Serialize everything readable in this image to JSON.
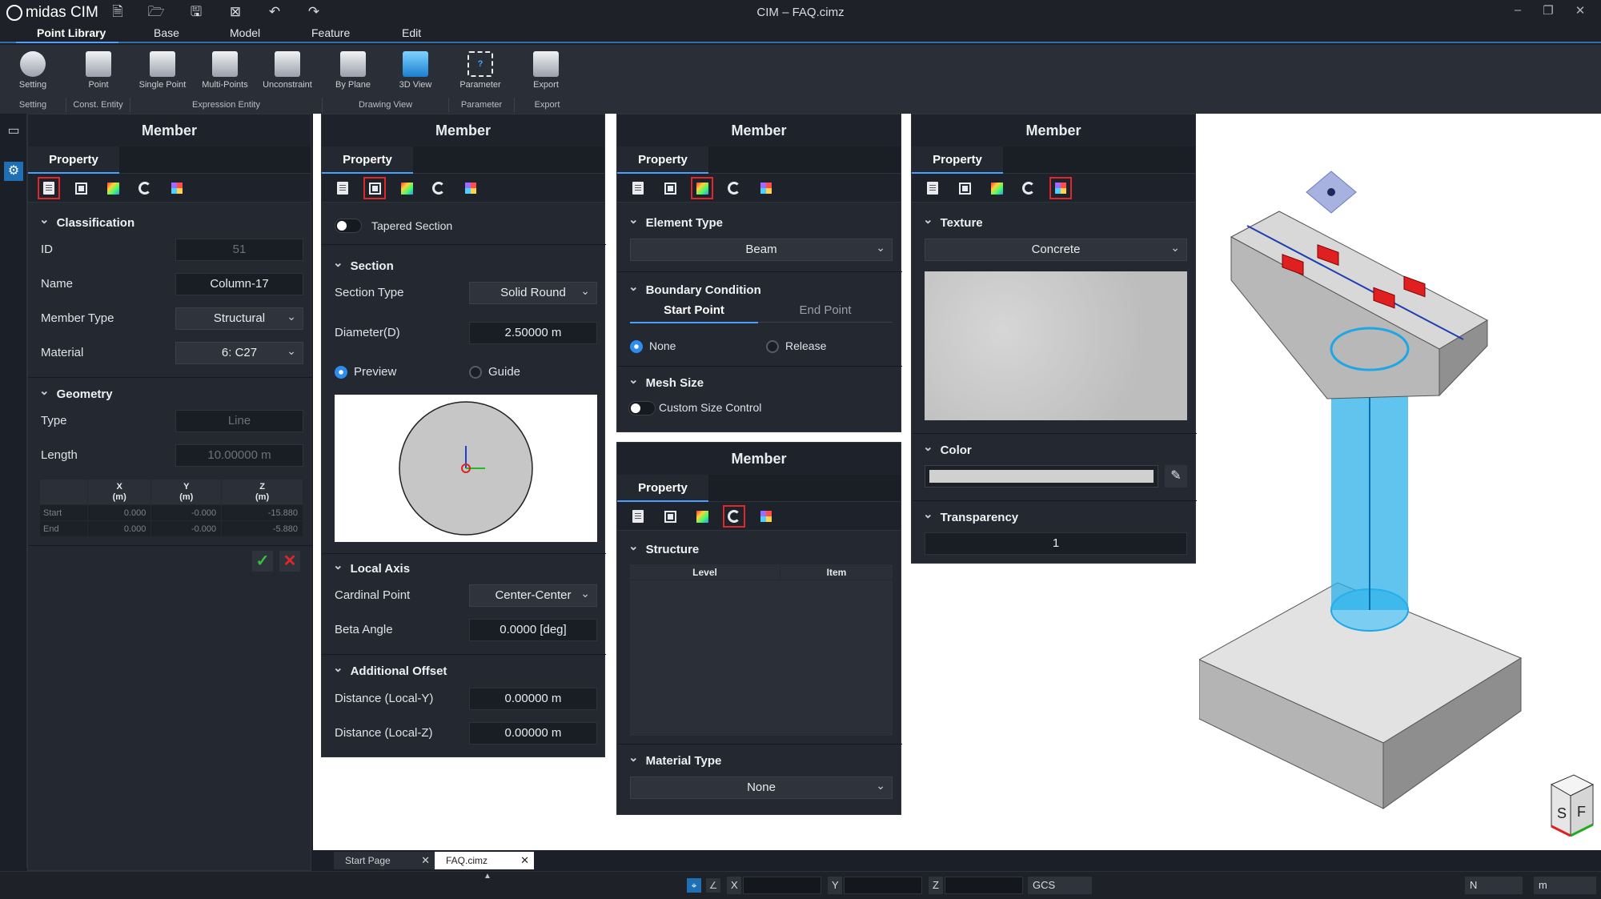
{
  "app": {
    "name": "midas CIM",
    "window_title": "CIM – FAQ.cimz"
  },
  "menu": {
    "tabs": [
      "Point Library",
      "Base",
      "Model",
      "Feature",
      "Edit"
    ],
    "active": "Point Library"
  },
  "ribbon": {
    "buttons": [
      {
        "label": "Setting",
        "icon": "gear-icon"
      },
      {
        "label": "Point",
        "icon": "cube-icon"
      },
      {
        "label": "Single Point",
        "icon": "cube-icon"
      },
      {
        "label": "Multi-Points",
        "icon": "cube-icon"
      },
      {
        "label": "Unconstraint",
        "icon": "cube-icon"
      },
      {
        "label": "By Plane",
        "icon": "plane-cube-icon"
      },
      {
        "label": "3D View",
        "icon": "3d-view-icon"
      },
      {
        "label": "Parameter",
        "icon": "parameter-icon"
      },
      {
        "label": "Export",
        "icon": "export-icon"
      }
    ],
    "groups": [
      "Setting",
      "Const. Entity",
      "Expression Entity",
      "Drawing View",
      "Parameter",
      "Export"
    ]
  },
  "panel1": {
    "title": "Member",
    "tab": "Property",
    "classification": "Classification",
    "id_label": "ID",
    "id_value": "51",
    "name_label": "Name",
    "name_value": "Column-17",
    "member_type_label": "Member Type",
    "member_type_value": "Structural",
    "material_label": "Material",
    "material_value": "6: C27",
    "geometry": "Geometry",
    "type_label": "Type",
    "type_value": "Line",
    "length_label": "Length",
    "length_value": "10.00000 m",
    "table": {
      "headers": [
        "",
        "X\n(m)",
        "Y\n(m)",
        "Z\n(m)"
      ],
      "rows": [
        [
          "Start",
          "0.000",
          "-0.000",
          "-15.880"
        ],
        [
          "End",
          "0.000",
          "-0.000",
          "-5.880"
        ]
      ]
    }
  },
  "panel2": {
    "title": "Member",
    "tab": "Property",
    "tapered": "Tapered Section",
    "section": "Section",
    "section_type_label": "Section Type",
    "section_type_value": "Solid Round",
    "diameter_label": "Diameter(D)",
    "diameter_value": "2.50000 m",
    "preview": "Preview",
    "guide": "Guide",
    "local_axis": "Local Axis",
    "cardinal_label": "Cardinal Point",
    "cardinal_value": "Center-Center",
    "beta_label": "Beta Angle",
    "beta_value": "0.0000 [deg]",
    "additional_offset": "Additional Offset",
    "dist_y_label": "Distance (Local-Y)",
    "dist_y_value": "0.00000 m",
    "dist_z_label": "Distance (Local-Z)",
    "dist_z_value": "0.00000 m"
  },
  "panel3": {
    "title": "Member",
    "tab": "Property",
    "element_type": "Element Type",
    "element_type_value": "Beam",
    "boundary": "Boundary Condition",
    "start_point": "Start Point",
    "end_point": "End Point",
    "none": "None",
    "release": "Release",
    "mesh_size": "Mesh Size",
    "custom_size": "Custom Size Control"
  },
  "panel4": {
    "title": "Member",
    "tab": "Property",
    "structure": "Structure",
    "level": "Level",
    "item": "Item",
    "material_type": "Material Type",
    "material_type_value": "None"
  },
  "panel5": {
    "title": "Member",
    "tab": "Property",
    "texture": "Texture",
    "texture_value": "Concrete",
    "color": "Color",
    "transparency": "Transparency",
    "transparency_value": "1"
  },
  "doc_tabs": [
    "Start Page",
    "FAQ.cimz"
  ],
  "status": {
    "x": "X",
    "y": "Y",
    "z": "Z",
    "cs": "GCS",
    "unit_force": "N",
    "unit_length": "m"
  },
  "colors": {
    "accent": "#4ba0ff",
    "highlight": "#e0272a",
    "column": "#1ea6e6"
  }
}
